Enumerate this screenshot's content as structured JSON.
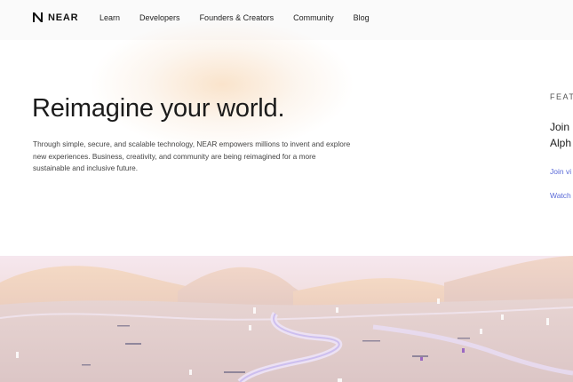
{
  "brand": {
    "name": "NEAR",
    "logo_icon": "near-logo-icon"
  },
  "nav": {
    "items": [
      {
        "label": "Learn"
      },
      {
        "label": "Developers"
      },
      {
        "label": "Founders & Creators"
      },
      {
        "label": "Community"
      },
      {
        "label": "Blog"
      }
    ]
  },
  "hero": {
    "title": "Reimagine your world.",
    "description": "Through simple, secure, and scalable technology, NEAR empowers millions to invent and explore new experiences. Business, creativity, and community are being reimagined for a more sustainable and inclusive future."
  },
  "featured": {
    "label": "FEAT",
    "title_line1": "Join",
    "title_line2": "Alph",
    "link1": "Join vi",
    "link2": "Watch"
  },
  "colors": {
    "topbar_bg": "#fafafa",
    "link": "#5a6ad8",
    "glow": "#f7d5b0",
    "landscape_sky": "#f6e7ee"
  }
}
